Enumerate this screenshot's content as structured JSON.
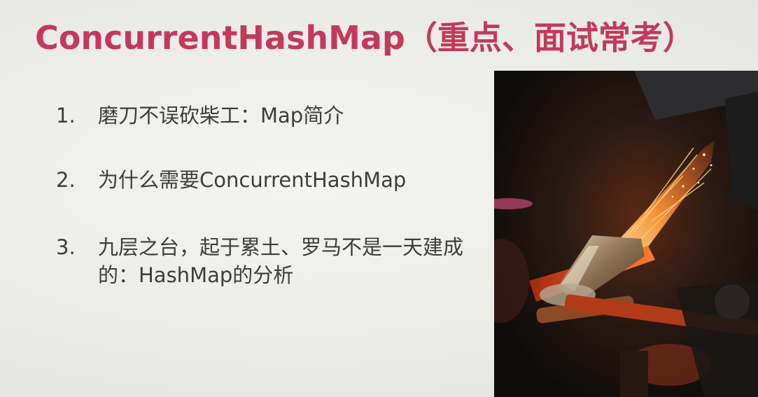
{
  "slide": {
    "title": "ConcurrentHashMap（重点、面试常考）",
    "items": [
      {
        "number": "1.",
        "text": "磨刀不误砍柴工：Map简介"
      },
      {
        "number": "2.",
        "text": "为什么需要ConcurrentHashMap"
      },
      {
        "number": "3.",
        "text": "九层之台，起于累土、罗马不是一天建成的：HashMap的分析"
      }
    ]
  },
  "colors": {
    "title": "#c23a5a",
    "body_text": "#3d3d3d",
    "background": "#ecece9"
  },
  "photo": {
    "icon": "blacksmith-forging-photo"
  }
}
